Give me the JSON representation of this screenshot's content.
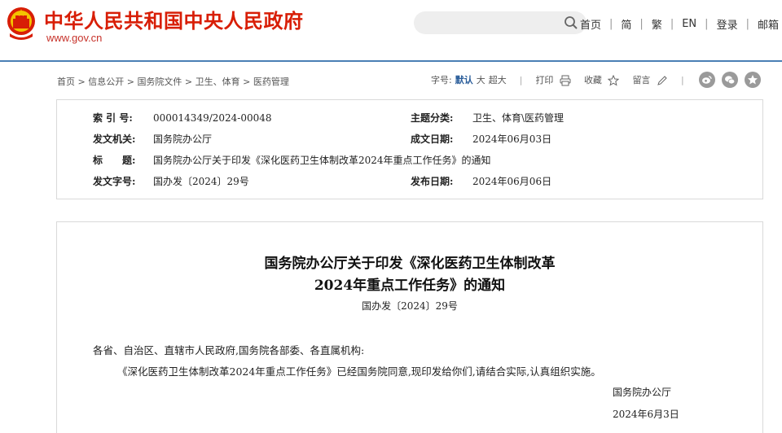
{
  "header": {
    "site_title": "中华人民共和国中央人民政府",
    "site_url": "www.gov.cn",
    "search": {
      "placeholder": "",
      "icon": "search-icon"
    },
    "nav": [
      "首页",
      "简",
      "繁",
      "EN",
      "登录",
      "邮箱"
    ]
  },
  "breadcrumb": [
    "首页",
    "信息公开",
    "国务院文件",
    "卫生、体育",
    "医药管理"
  ],
  "breadcrumb_sep": " > ",
  "tools": {
    "font_size_label": "字号:",
    "font_default": "默认",
    "font_large": "大",
    "font_xlarge": "超大",
    "print_label": "打印",
    "favorite_label": "收藏",
    "comment_label": "留言"
  },
  "social_icons": [
    "weibo-icon",
    "wechat-icon",
    "favorite-icon"
  ],
  "info": {
    "index_label": "索 引 号:",
    "index_value": "000014349/2024-00048",
    "category_label": "主题分类:",
    "category_value": "卫生、体育\\医药管理",
    "issuer_label": "发文机关:",
    "issuer_value": "国务院办公厅",
    "created_label": "成文日期:",
    "created_value": "2024年06月03日",
    "title_label": "标　　题:",
    "title_value": "国务院办公厅关于印发《深化医药卫生体制改革2024年重点工作任务》的通知",
    "docno_label": "发文字号:",
    "docno_value": "国办发〔2024〕29号",
    "published_label": "发布日期:",
    "published_value": "2024年06月06日"
  },
  "document": {
    "title_line1": "国务院办公厅关于印发《深化医药卫生体制改革",
    "title_line2": "2024年重点工作任务》的通知",
    "doc_number": "国办发〔2024〕29号",
    "addressee": "各省、自治区、直辖市人民政府,国务院各部委、各直属机构:",
    "body": "《深化医药卫生体制改革2024年重点工作任务》已经国务院同意,现印发给你们,请结合实际,认真组织实施。",
    "signer": "国务院办公厅",
    "sign_date": "2024年6月3日"
  },
  "colors": {
    "brand_red": "#d81e06",
    "header_rule": "#4a7fb5",
    "active_font": "#2a5d9a",
    "social_grey": "#9a9a9a"
  }
}
